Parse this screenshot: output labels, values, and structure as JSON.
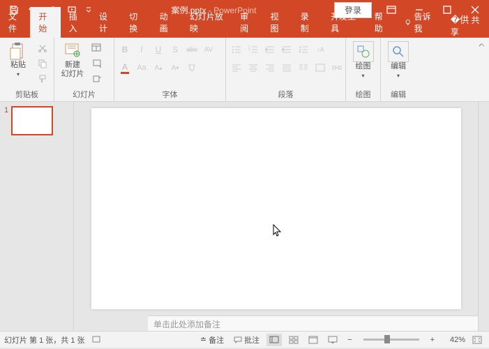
{
  "titlebar": {
    "filename": "案例.pptx",
    "app": "PowerPoint",
    "login": "登录"
  },
  "tabs": {
    "file": "文件",
    "home": "开始",
    "insert": "插入",
    "design": "设计",
    "transitions": "切换",
    "animations": "动画",
    "slideshow": "幻灯片放映",
    "review": "审阅",
    "view": "视图",
    "record": "录制",
    "developer": "开发工具",
    "help": "帮助",
    "tellme": "告诉我",
    "share": "共享"
  },
  "ribbon": {
    "clipboard": {
      "label": "剪贴板",
      "paste": "粘贴"
    },
    "slides": {
      "label": "幻灯片",
      "new": "新建\n幻灯片"
    },
    "font": {
      "label": "字体",
      "b": "B",
      "i": "I",
      "u": "U",
      "s": "S",
      "av": "AV",
      "abc": "abc",
      "aa": "Aa",
      "a_plus": "A+",
      "a_minus": "A-"
    },
    "paragraph": {
      "label": "段落"
    },
    "drawing": {
      "label": "绘图",
      "btn": "绘图"
    },
    "editing": {
      "label": "编辑",
      "btn": "编辑"
    }
  },
  "thumbs": {
    "num1": "1"
  },
  "notes": {
    "placeholder": "单击此处添加备注"
  },
  "status": {
    "slide_info": "幻灯片 第 1 张，共 1 张",
    "notes": "备注",
    "comments": "批注",
    "zoom": "42%"
  }
}
